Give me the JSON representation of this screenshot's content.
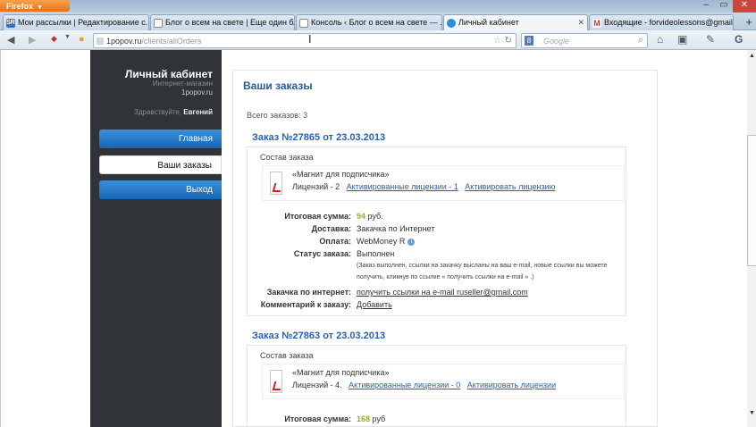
{
  "browser": {
    "app_button": "Firefox",
    "tabs": [
      {
        "label": "Мои рассылки | Редактирование с...",
        "icon": "SR"
      },
      {
        "label": "Блог о всем на свете | Еще один бл...",
        "icon": ""
      },
      {
        "label": "Консоль ‹ Блог о всем на свете — ...",
        "icon": ""
      },
      {
        "label": "Личный кабинет",
        "icon": ""
      },
      {
        "label": "Входящие - forvideolessons@gmail....",
        "icon": "M"
      }
    ],
    "new_tab": "+",
    "url_host": "1popov.ru",
    "url_path": "/clients/allOrders",
    "search_placeholder": "Google",
    "search_engine_icon": "8"
  },
  "sidebar": {
    "title": "Личный кабинет",
    "subtitle": "Интернет-магазин",
    "domain": "1popov.ru",
    "greeting_prefix": "Здравствуйте,",
    "user_name": "Евгений",
    "menu": [
      {
        "label": "Главная"
      },
      {
        "label": "Ваши заказы"
      },
      {
        "label": "Выход"
      }
    ]
  },
  "main": {
    "heading": "Ваши заказы",
    "total_orders": "Всего заказов: 3",
    "orders": [
      {
        "title": "Заказ №27865 от 23.03.2013",
        "composition_label": "Состав заказа",
        "product_name": "«Магнит для подписчика»",
        "licenses": "Лицензий - 2",
        "activated_link": "Активированные лицензии - 1",
        "activate_link": "Активировать лицензию",
        "total_label": "Итоговая сумма:",
        "total_value": "94",
        "currency": "руб.",
        "delivery_label": "Доставка:",
        "delivery_value": "Закачка по Интернет",
        "payment_label": "Оплата:",
        "payment_value": "WebMoney R",
        "status_label": "Статус заказа:",
        "status_value": "Выполнен",
        "status_note": "(Заказ выполнен, ссылки на закачку высланы на ваш e-mail, новые ссылки вы можете получить, кликнув по ссылке « получить ссылки на e-mail » .)",
        "download_label": "Закачка по интернет:",
        "download_link": "получить ссылки на e-mail ruseller@gmail.com",
        "comment_label": "Комментарий к заказу:",
        "comment_link": "Добавить"
      },
      {
        "title": "Заказ №27863 от 23.03.2013",
        "composition_label": "Состав заказа",
        "product_name": "«Магнит для подписчика»",
        "licenses": "Лицензий - 4.",
        "activated_link": "Активированные лицензии - 0",
        "activate_link": "Активировать лицензии",
        "total_label": "Итоговая сумма:",
        "total_value": "168",
        "currency": "руб"
      }
    ]
  }
}
